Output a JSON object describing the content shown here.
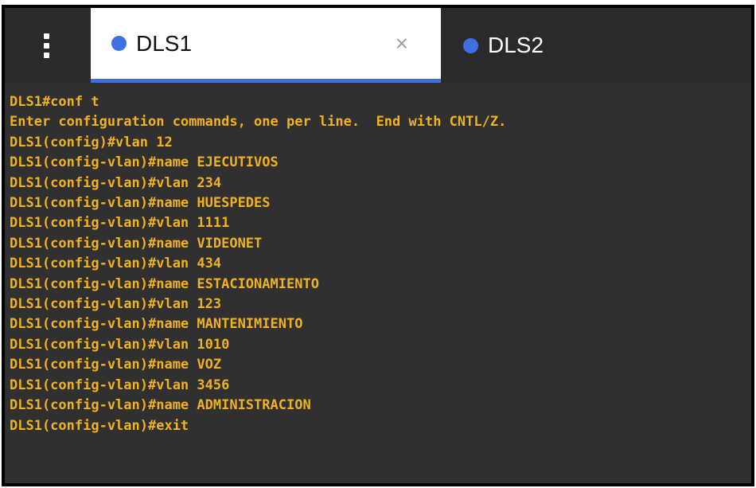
{
  "tabs": [
    {
      "label": "DLS1",
      "dot_color": "#3f6fe0",
      "active": true
    },
    {
      "label": "DLS2",
      "dot_color": "#3f6fe0",
      "active": false
    }
  ],
  "icons": {
    "menu": "kebab-menu-icon",
    "close": "close-icon",
    "close_glyph": "×"
  },
  "terminal": {
    "text_color": "#f2b21f",
    "lines": [
      "DLS1#conf t",
      "Enter configuration commands, one per line.  End with CNTL/Z.",
      "DLS1(config)#vlan 12",
      "DLS1(config-vlan)#name EJECUTIVOS",
      "DLS1(config-vlan)#vlan 234",
      "DLS1(config-vlan)#name HUESPEDES",
      "DLS1(config-vlan)#vlan 1111",
      "DLS1(config-vlan)#name VIDEONET",
      "DLS1(config-vlan)#vlan 434",
      "DLS1(config-vlan)#name ESTACIONAMIENTO",
      "DLS1(config-vlan)#vlan 123",
      "DLS1(config-vlan)#name MANTENIMIENTO",
      "DLS1(config-vlan)#vlan 1010",
      "DLS1(config-vlan)#name VOZ",
      "DLS1(config-vlan)#vlan 3456",
      "DLS1(config-vlan)#name ADMINISTRACION",
      "DLS1(config-vlan)#exit"
    ]
  }
}
